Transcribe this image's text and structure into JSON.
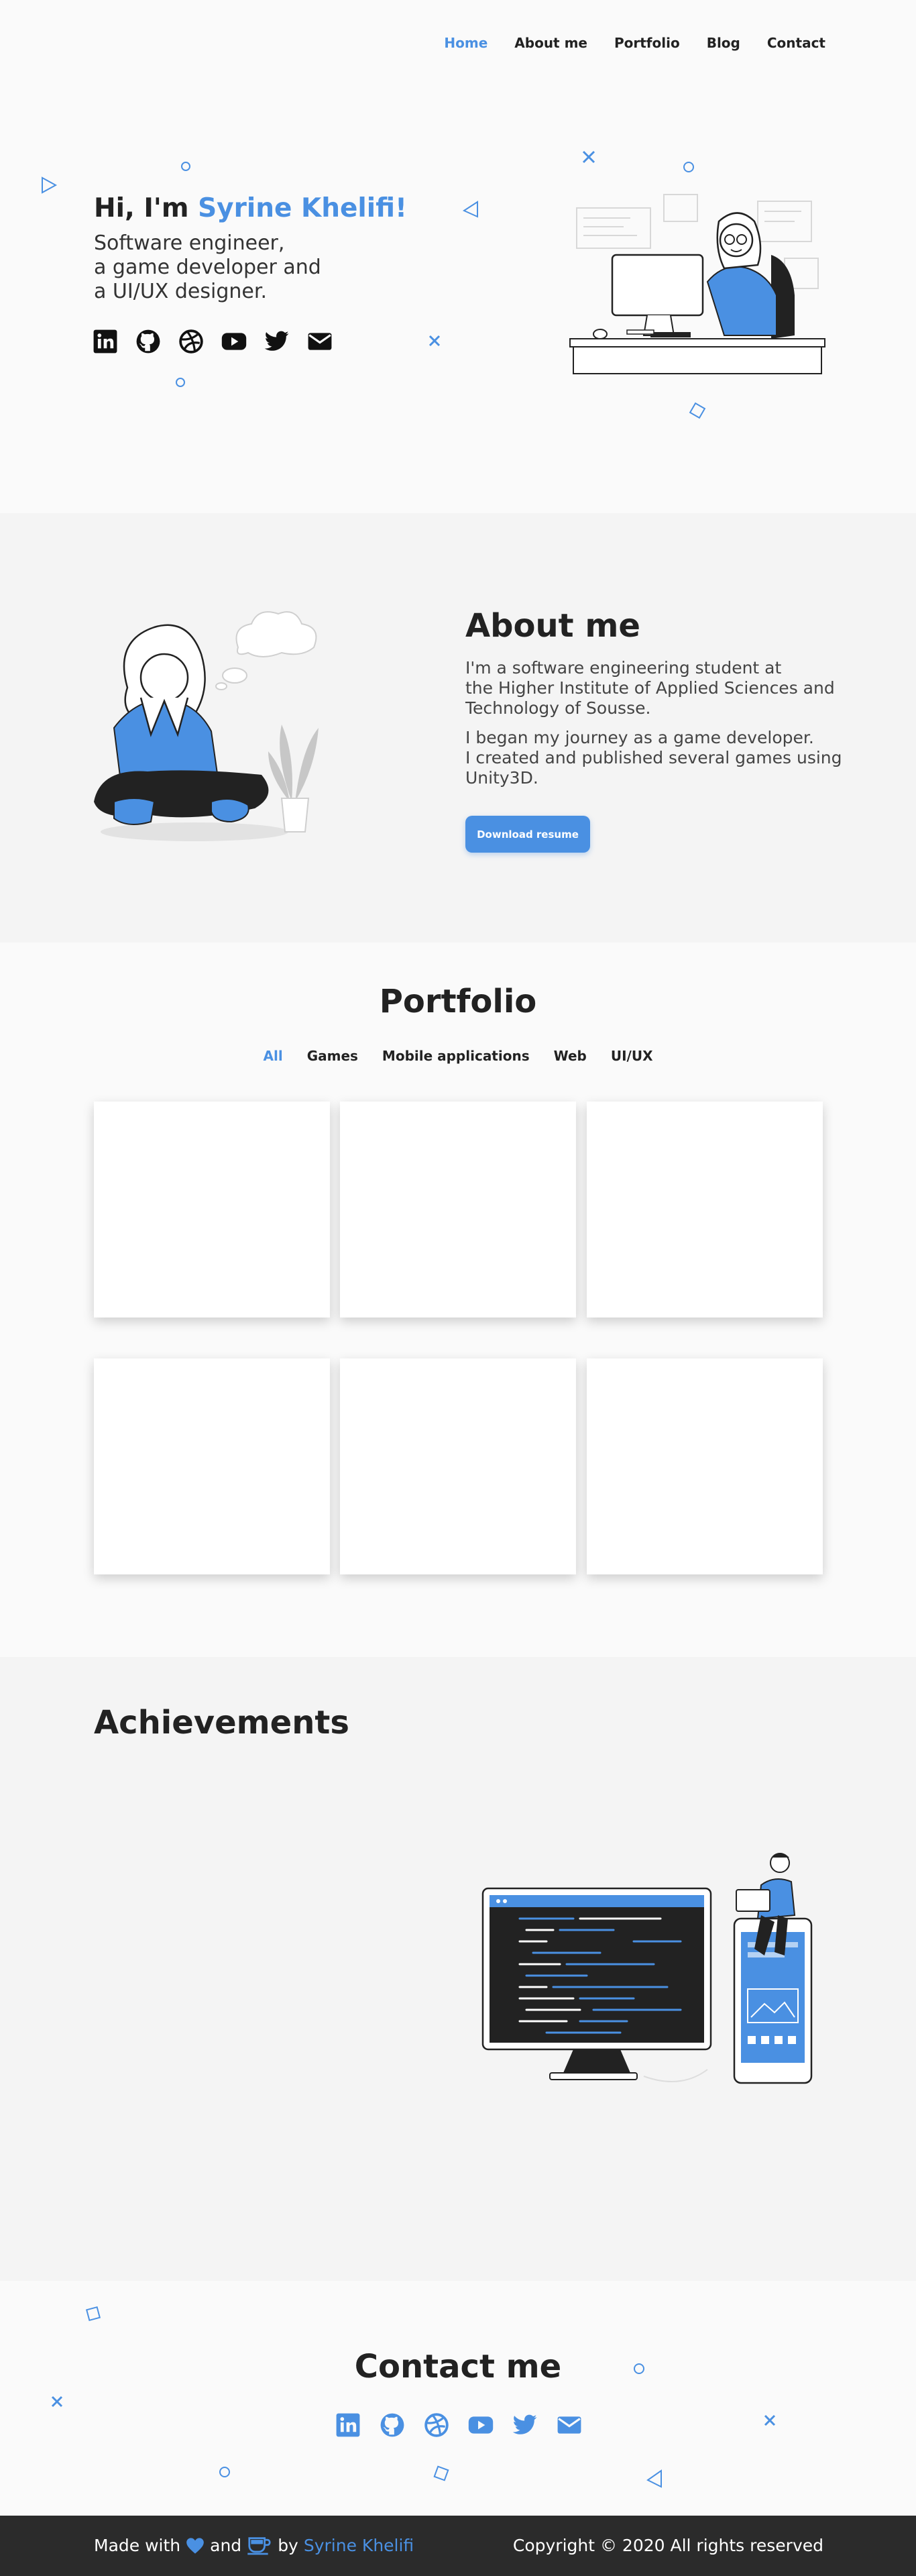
{
  "nav": {
    "items": [
      {
        "label": "Home",
        "active": true
      },
      {
        "label": "About me",
        "active": false
      },
      {
        "label": "Portfolio",
        "active": false
      },
      {
        "label": "Blog",
        "active": false
      },
      {
        "label": "Contact",
        "active": false
      }
    ]
  },
  "hero": {
    "greeting": "Hi, I'm ",
    "name": "Syrine Khelifi!",
    "subtitle_lines": [
      "Software engineer,",
      "a game developer and",
      "a UI/UX designer."
    ],
    "social_icons": [
      "linkedin-icon",
      "github-icon",
      "dribbble-icon",
      "youtube-icon",
      "twitter-icon",
      "email-icon"
    ]
  },
  "about": {
    "title": "About me",
    "paragraph1_lines": [
      "I'm a software engineering student at",
      "the Higher Institute of Applied Sciences and",
      "Technology of Sousse."
    ],
    "paragraph2_lines": [
      "I began my journey as a game developer.",
      "I created and published several games using",
      "Unity3D."
    ],
    "button_label": "Download resume"
  },
  "portfolio": {
    "title": "Portfolio",
    "filters": [
      {
        "label": "All",
        "active": true
      },
      {
        "label": "Games",
        "active": false
      },
      {
        "label": "Mobile applications",
        "active": false
      },
      {
        "label": "Web",
        "active": false
      },
      {
        "label": "UI/UX",
        "active": false
      }
    ],
    "card_count": 6
  },
  "achievements": {
    "title": "Achievements"
  },
  "contact": {
    "title": "Contact me",
    "social_icons": [
      "linkedin-icon",
      "github-icon",
      "dribbble-icon",
      "youtube-icon",
      "twitter-icon",
      "email-icon"
    ]
  },
  "footer": {
    "made_with": "Made with",
    "and": "and",
    "by": "by",
    "author": "Syrine Khelifi",
    "copyright": "Copyright © 2020 All rights reserved"
  },
  "colors": {
    "accent": "#4a90e2",
    "text": "#222222",
    "footer_bg": "#2b2b2b"
  }
}
